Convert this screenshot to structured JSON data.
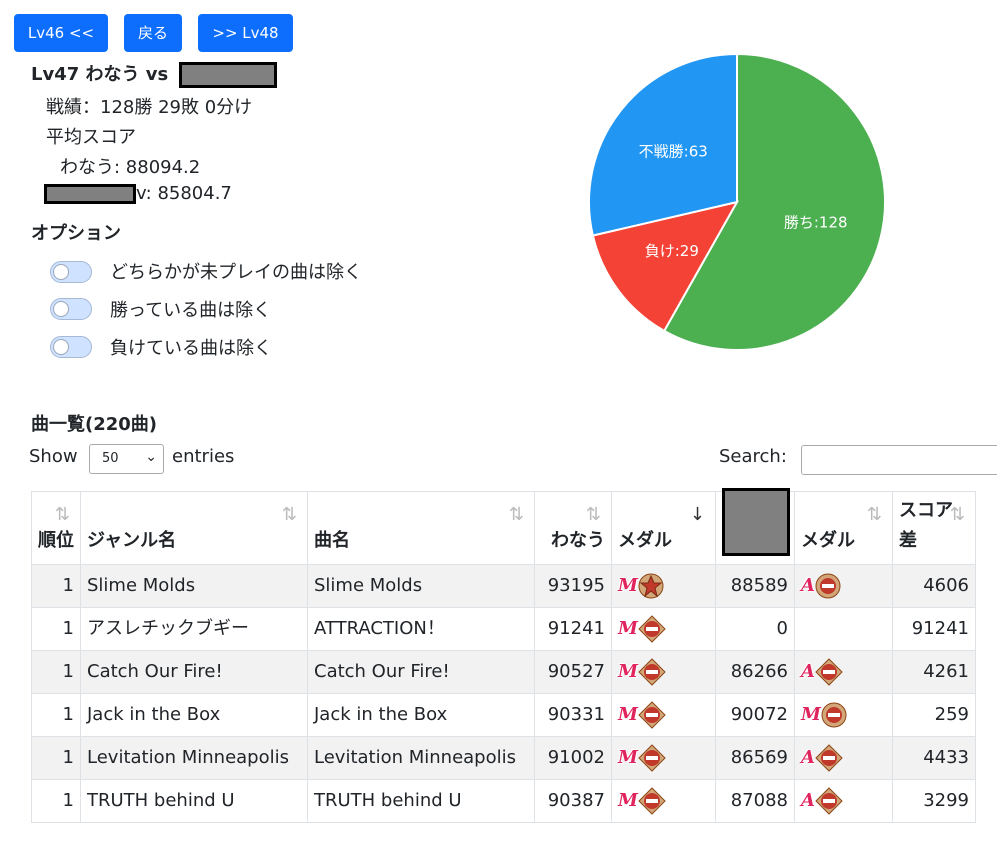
{
  "nav": {
    "prev": "Lv46 <<",
    "back": "戻る",
    "next": ">> Lv48"
  },
  "header": {
    "title": "Lv47 わなう vs"
  },
  "stats": {
    "record": "戦績：128勝 29敗 0分け",
    "avg_label": "平均スコア",
    "player_avg": "わなう: 88094.2",
    "rival_avg": "v: 85804.7"
  },
  "options": {
    "title": "オプション",
    "items": [
      "どちらかが未プレイの曲は除く",
      "勝っている曲は除く",
      "負けている曲は除く"
    ]
  },
  "chart_data": {
    "type": "pie",
    "slices": [
      {
        "label": "勝ち:128",
        "value": 128,
        "color": "#4caf50"
      },
      {
        "label": "負け:29",
        "value": 29,
        "color": "#f44336"
      },
      {
        "label": "不戦勝:63",
        "value": 63,
        "color": "#2196f3"
      }
    ]
  },
  "list": {
    "title": "曲一覧(220曲)",
    "show_label": "Show",
    "entries_label": "entries",
    "entries_value": "50",
    "search_label": "Search:"
  },
  "table": {
    "headers": [
      "順位",
      "ジャンル名",
      "曲名",
      "わなう",
      "メダル",
      "",
      "メダル",
      "スコア差"
    ],
    "rows": [
      {
        "rank": "1",
        "genre": "Slime Molds",
        "song": "Slime Molds",
        "p_score": "93195",
        "p_medal": [
          "M",
          "star"
        ],
        "r_score": "88589",
        "r_medal": [
          "A",
          "circle"
        ],
        "diff": "4606"
      },
      {
        "rank": "1",
        "genre": "アスレチックブギー",
        "song": "ATTRACTION！",
        "p_score": "91241",
        "p_medal": [
          "M",
          "diamond"
        ],
        "r_score": "0",
        "r_medal": [],
        "diff": "91241"
      },
      {
        "rank": "1",
        "genre": "Catch Our Fire!",
        "song": "Catch Our Fire!",
        "p_score": "90527",
        "p_medal": [
          "M",
          "diamond"
        ],
        "r_score": "86266",
        "r_medal": [
          "A",
          "diamond"
        ],
        "diff": "4261"
      },
      {
        "rank": "1",
        "genre": "Jack in the Box",
        "song": "Jack in the Box",
        "p_score": "90331",
        "p_medal": [
          "M",
          "diamond"
        ],
        "r_score": "90072",
        "r_medal": [
          "M",
          "circle"
        ],
        "diff": "259"
      },
      {
        "rank": "1",
        "genre": "Levitation Minneapolis",
        "song": "Levitation Minneapolis",
        "p_score": "91002",
        "p_medal": [
          "M",
          "diamond"
        ],
        "r_score": "86569",
        "r_medal": [
          "A",
          "diamond"
        ],
        "diff": "4433"
      },
      {
        "rank": "1",
        "genre": "TRUTH behind U",
        "song": "TRUTH behind U",
        "p_score": "90387",
        "p_medal": [
          "M",
          "diamond"
        ],
        "r_score": "87088",
        "r_medal": [
          "A",
          "diamond"
        ],
        "diff": "3299"
      }
    ]
  }
}
